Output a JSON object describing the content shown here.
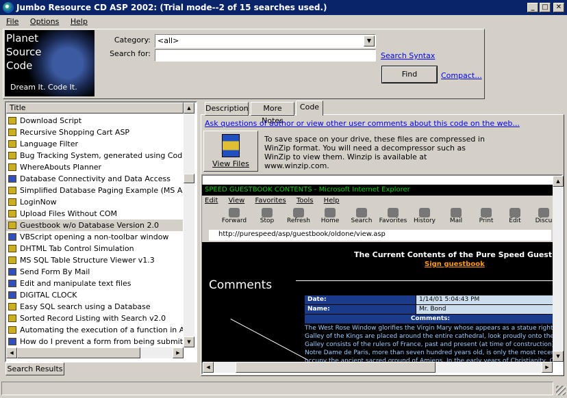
{
  "window": {
    "title": "Jumbo Resource CD ASP 2002: (Trial mode--2 of 15 searches used.)"
  },
  "menu": [
    "File",
    "Options",
    "Help"
  ],
  "logo": {
    "line1": "Planet",
    "line2": "Source",
    "line3": "Code",
    "slogan": "Dream It.  Code It."
  },
  "search": {
    "category_label": "Category:",
    "category_value": "<all>",
    "search_label": "Search for:",
    "search_value": "",
    "syntax_link": "Search Syntax",
    "find_button": "Find",
    "compact_link": "Compact..."
  },
  "list": {
    "header": "Title",
    "items": [
      {
        "label": "Download Script",
        "icon": "zip"
      },
      {
        "label": "Recursive Shopping Cart ASP",
        "icon": "zip"
      },
      {
        "label": "Language Filter",
        "icon": "zip"
      },
      {
        "label": "Bug Tracking System, generated using CodeCharge",
        "icon": "zip"
      },
      {
        "label": "WhereAbouts Planner",
        "icon": "zip"
      },
      {
        "label": "Database Connectivity and Data Access",
        "icon": "book"
      },
      {
        "label": "Simplified Database Paging Example (MS Access/",
        "icon": "zip"
      },
      {
        "label": "LoginNow",
        "icon": "zip"
      },
      {
        "label": "Upload Files Without COM",
        "icon": "zip"
      },
      {
        "label": "Guestbook w/o Database Version 2.0",
        "icon": "zip",
        "selected": true
      },
      {
        "label": "VBScript opening a non-toolbar window",
        "icon": "script"
      },
      {
        "label": "DHTML Tab Control Simulation",
        "icon": "zip"
      },
      {
        "label": "MS SQL Table Structure Viewer v1.3",
        "icon": "zip"
      },
      {
        "label": "Send Form By Mail",
        "icon": "script"
      },
      {
        "label": "Edit and manipulate text files",
        "icon": "script"
      },
      {
        "label": "DIGITAL CLOCK",
        "icon": "script"
      },
      {
        "label": "Easy SQL search using a Database",
        "icon": "zip"
      },
      {
        "label": "Sorted Record Listing with Search v2.0",
        "icon": "zip"
      },
      {
        "label": "Automating the execution of a function in ASP",
        "icon": "zip"
      },
      {
        "label": "How do I prevent a form from being submitted, until",
        "icon": "book"
      }
    ],
    "bottom_tab": "Search Results"
  },
  "detail": {
    "tabs": [
      "Description",
      "More Notes",
      "Code"
    ],
    "active_tab": "Code",
    "ask_link": "Ask questions of author or view other user comments about this code on the web...",
    "view_files": "View Files",
    "zip_note": "To save space on your drive, these files are compressed in WinZip format.  You will need a decompressor such as WinZip to view them.  Winzip is available at www.winzip.com."
  },
  "preview": {
    "banner": "SPEED GUESTBOOK CONTENTS - Microsoft Internet Explorer",
    "menu": [
      "Edit",
      "View",
      "Favorites",
      "Tools",
      "Help"
    ],
    "toolbar": [
      "Forward",
      "Stop",
      "Refresh",
      "Home",
      "Search",
      "Favorites",
      "History",
      "Mail",
      "Print",
      "Edit",
      "Discu"
    ],
    "address": "http://purespeed/asp/guestbook/oldone/view.asp",
    "heading": "The Current Contents of the Pure Speed Guestbook",
    "sign_link": "Sign guestbook",
    "comments_label": "Comments",
    "date_label": "Date:",
    "date_value": "1/14/01 5:04:43 PM",
    "name_label": "Name:",
    "name_value": "Mr. Bond",
    "comments_header": "Comments:",
    "lines": [
      "The West Rose Window glorifies the Virgin Mary whose appears as a statue right below it",
      "Galley of the Kings are placed around the entire cathedral, look proudly onto the crowds b",
      "Galley consists of the rulers of France, past and present (at time of construction).",
      "Notre Dame de Paris, more than seven hundred years old, is only the most recent of holy",
      "occupy the ancient sacred ground of Amiens. In the early years of Christianity, Childebert"
    ]
  }
}
